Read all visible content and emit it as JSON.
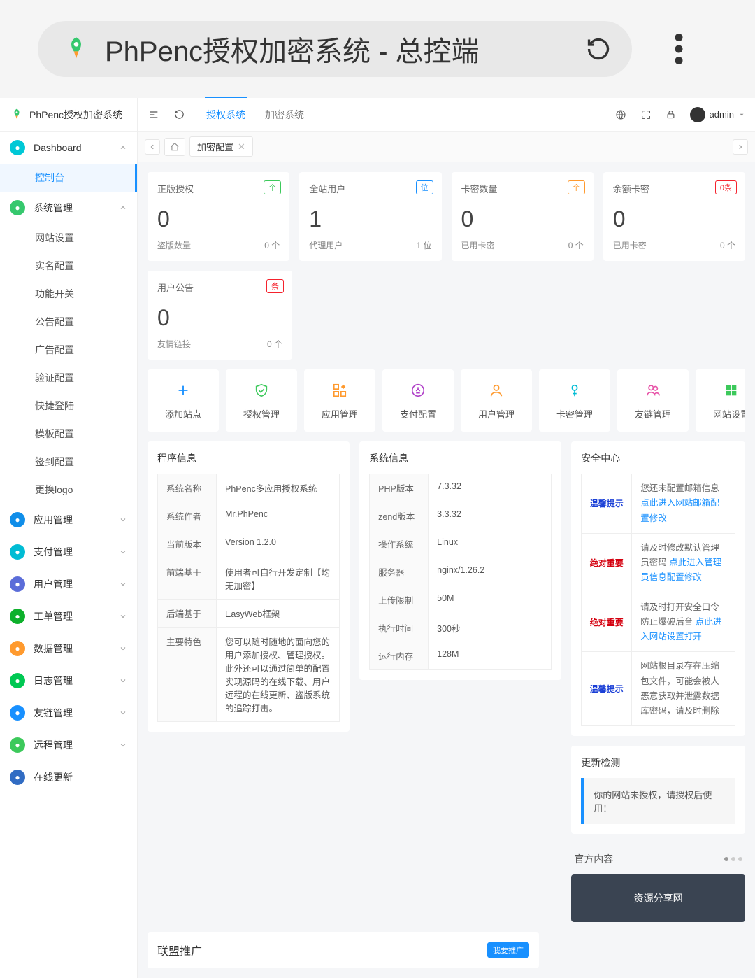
{
  "browser": {
    "title": "PhPenc授权加密系统 - 总控端"
  },
  "sidebar": {
    "logo_text": "PhPenc授权加密系统",
    "groups": [
      {
        "label": "Dashboard",
        "icon_color": "bg-cyan",
        "children": [
          "控制台"
        ],
        "open": true,
        "active_child": 0
      },
      {
        "label": "系统管理",
        "icon_color": "bg-green",
        "open": true,
        "children": [
          "网站设置",
          "实名配置",
          "功能开关",
          "公告配置",
          "广告配置",
          "验证配置",
          "快捷登陆",
          "模板配置",
          "签到配置",
          "更换logo"
        ]
      },
      {
        "label": "应用管理",
        "icon_color": "bg-blue",
        "open": false
      },
      {
        "label": "支付管理",
        "icon_color": "bg-teal",
        "open": false
      },
      {
        "label": "用户管理",
        "icon_color": "bg-purple",
        "open": false
      },
      {
        "label": "工单管理",
        "icon_color": "bg-lime",
        "open": false
      },
      {
        "label": "数据管理",
        "icon_color": "bg-orange",
        "open": false
      },
      {
        "label": "日志管理",
        "icon_color": "bg-bgreen",
        "open": false
      },
      {
        "label": "友链管理",
        "icon_color": "bg-link",
        "open": false
      },
      {
        "label": "远程管理",
        "icon_color": "bg-share",
        "open": false
      },
      {
        "label": "在线更新",
        "icon_color": "bg-navy",
        "open": false,
        "nochev": true
      }
    ]
  },
  "topbar": {
    "tabs": [
      "授权系统",
      "加密系统"
    ],
    "active_tab": 0,
    "username": "admin"
  },
  "crumb": {
    "tab_label": "加密配置"
  },
  "stats_r1": [
    {
      "title": "正版授权",
      "badge": "个",
      "badge_cls": "bdg-green",
      "big": "0",
      "sub_l": "盗版数量",
      "sub_r": "0 个"
    },
    {
      "title": "全站用户",
      "badge": "位",
      "badge_cls": "bdg-blue",
      "big": "1",
      "sub_l": "代理用户",
      "sub_r": "1 位"
    },
    {
      "title": "卡密数量",
      "badge": "个",
      "badge_cls": "bdg-orange",
      "big": "0",
      "sub_l": "已用卡密",
      "sub_r": "0 个"
    },
    {
      "title": "余额卡密",
      "badge": "0条",
      "badge_cls": "bdg-red",
      "big": "0",
      "sub_l": "已用卡密",
      "sub_r": "0 个"
    }
  ],
  "stats_r2": [
    {
      "title": "用户公告",
      "badge": "条",
      "badge_cls": "bdg-red",
      "big": "0",
      "sub_l": "友情链接",
      "sub_r": "0 个"
    }
  ],
  "quick": [
    {
      "label": "添加站点",
      "color": "#1890ff"
    },
    {
      "label": "授权管理",
      "color": "#3cc95b"
    },
    {
      "label": "应用管理",
      "color": "#ff9a2e"
    },
    {
      "label": "支付配置",
      "color": "#b041c8"
    },
    {
      "label": "用户管理",
      "color": "#ff9a2e"
    },
    {
      "label": "卡密管理",
      "color": "#00bcd4"
    },
    {
      "label": "友链管理",
      "color": "#e754a8"
    },
    {
      "label": "网站设置",
      "color": "#3cc95b"
    }
  ],
  "program_info": {
    "title": "程序信息",
    "rows": [
      [
        "系统名称",
        "PhPenc多应用授权系统"
      ],
      [
        "系统作者",
        "Mr.PhPenc"
      ],
      [
        "当前版本",
        "Version 1.2.0"
      ],
      [
        "前端基于",
        "使用者可自行开发定制【均无加密】"
      ],
      [
        "后端基于",
        "EasyWeb框架"
      ],
      [
        "主要特色",
        "您可以随时随地的面向您的用户添加授权、管理授权。此外还可以通过简单的配置实现源码的在线下载、用户远程的在线更新、盗版系统的追踪打击。"
      ]
    ]
  },
  "system_info": {
    "title": "系统信息",
    "rows": [
      [
        "PHP版本",
        "7.3.32"
      ],
      [
        "zend版本",
        "3.3.32"
      ],
      [
        "操作系统",
        "Linux"
      ],
      [
        "服务器",
        "nginx/1.26.2"
      ],
      [
        "上传限制",
        "50M"
      ],
      [
        "执行时间",
        "300秒"
      ],
      [
        "运行内存",
        "128M"
      ]
    ]
  },
  "security": {
    "title": "安全中心",
    "rows": [
      {
        "tag": "温馨提示",
        "tag_cls": "tag-blue",
        "text": "您还未配置邮箱信息 ",
        "link": "点此进入网站邮箱配置修改"
      },
      {
        "tag": "绝对重要",
        "tag_cls": "tag-red",
        "text": "请及时修改默认管理员密码 ",
        "link": "点此进入管理员信息配置修改"
      },
      {
        "tag": "绝对重要",
        "tag_cls": "tag-red",
        "text": "请及时打开安全口令防止爆破后台 ",
        "link": "点此进入网站设置打开"
      },
      {
        "tag": "温馨提示",
        "tag_cls": "tag-blue",
        "text": "网站根目录存在压缩包文件，可能会被人恶意获取并泄露数据库密码，请及时删除",
        "link": ""
      }
    ]
  },
  "promo": {
    "title": "联盟推广",
    "button": "我要推广"
  },
  "update": {
    "title": "更新检测",
    "message": "你的网站未授权，请授权后使用！"
  },
  "official": {
    "title": "官方内容",
    "card": "资源分享网"
  }
}
